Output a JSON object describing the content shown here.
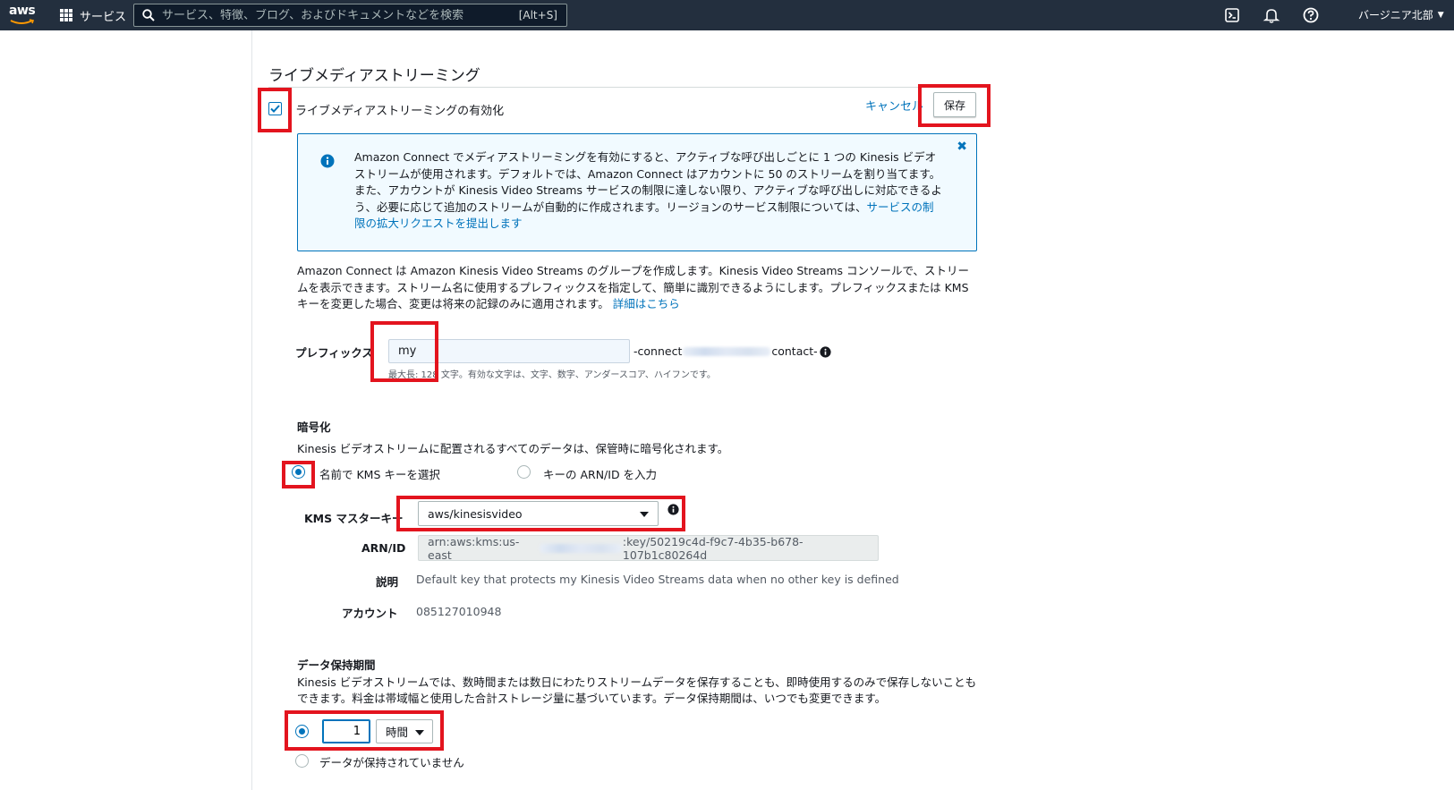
{
  "topnav": {
    "logo_text": "aws",
    "services_label": "サービス",
    "search_placeholder": "サービス、特徴、ブログ、およびドキュメントなどを検索",
    "search_shortcut": "[Alt+S]",
    "region": "バージニア北部",
    "icons": [
      "cloudshell-icon",
      "notifications-bell-icon",
      "help-icon"
    ]
  },
  "section": {
    "title": "ライブメディアストリーミング",
    "enable_label": "ライブメディアストリーミングの有効化",
    "enable_checked": true,
    "cancel_label": "キャンセル",
    "save_label": "保存"
  },
  "info_box": {
    "text": "Amazon Connect でメディアストリーミングを有効にすると、アクティブな呼び出しごとに 1 つの Kinesis ビデオストリームが使用されます。デフォルトでは、Amazon Connect はアカウントに 50 のストリームを割り当てます。また、アカウントが Kinesis Video Streams サービスの制限に達しない限り、アクティブな呼び出しに対応できるよう、必要に応じて追加のストリームが自動的に作成されます。リージョンのサービス制限については、",
    "link": "サービスの制限の拡大リクエストを提出します"
  },
  "description": {
    "text": "Amazon Connect は Amazon Kinesis Video Streams のグループを作成します。Kinesis Video Streams コンソールで、ストリームを表示できます。ストリーム名に使用するプレフィックスを指定して、簡単に識別できるようにします。プレフィックスまたは KMS キーを変更した場合、変更は将来の記録のみに適用されます。",
    "link": "詳細はこちら"
  },
  "prefix": {
    "label": "プレフィックス",
    "value": "my",
    "suffix_start": "-connect",
    "suffix_end": "contact-",
    "hint": "最大長: 128 文字。有効な文字は、文字、数字、アンダースコア、ハイフンです。"
  },
  "encryption": {
    "title": "暗号化",
    "description": "Kinesis ビデオストリームに配置されるすべてのデータは、保管時に暗号化されます。",
    "option_name": "名前で KMS キーを選択",
    "option_arn": "キーの ARN/ID を入力",
    "selected": "name",
    "kms_label": "KMS マスターキー",
    "kms_value": "aws/kinesisvideo",
    "arn_label": "ARN/ID",
    "arn_value_start": "arn:aws:kms:us-east",
    "arn_value_end": ":key/50219c4d-f9c7-4b35-b678-107b1c80264d",
    "desc_label": "説明",
    "desc_value": "Default key that protects my Kinesis Video Streams data when no other key is defined",
    "account_label": "アカウント",
    "account_value": "085127010948"
  },
  "retention": {
    "title": "データ保持期間",
    "description": "Kinesis ビデオストリームでは、数時間または数日にわたりストリームデータを保存することも、即時使用するのみで保存しないこともできます。料金は帯域幅と使用した合計ストレージ量に基づいています。データ保持期間は、いつでも変更できます。",
    "value": "1",
    "unit": "時間",
    "no_retention_label": "データが保持されていません",
    "selected": "period"
  },
  "colors": {
    "nav_bg": "#232f3e",
    "link": "#0073bb",
    "highlight": "#e3141e",
    "info_bg": "#f1faff"
  }
}
